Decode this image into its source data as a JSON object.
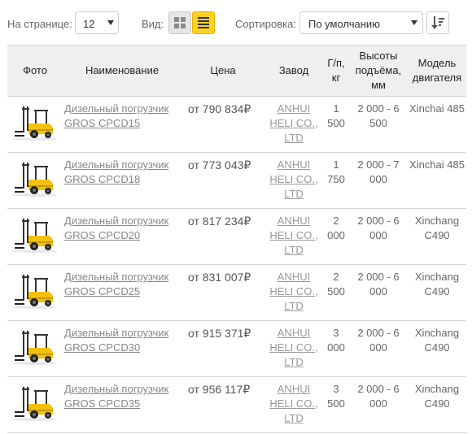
{
  "toolbar": {
    "per_page_label": "На странице:",
    "per_page_value": "12",
    "view_label": "Вид:",
    "sort_label": "Сортировка:",
    "sort_value": "По умолчанию",
    "accent_color": "#ffd21f"
  },
  "table": {
    "headers": {
      "photo": "Фото",
      "name": "Наименование",
      "price": "Цена",
      "factory": "Завод",
      "capacity": "Г/п, кг",
      "lift": "Высоты подъёма, мм",
      "engine": "Модель двигателя"
    },
    "rows": [
      {
        "name": "Дизельный погрузчик GROS CPCD15",
        "price": "от 790 834₽",
        "factory": "ANHUI HELI CO., LTD",
        "capacity": "1 500",
        "lift": "2 000 - 6 500",
        "engine": "Xinchai 485"
      },
      {
        "name": "Дизельный погрузчик GROS CPCD18",
        "price": "от 773 043₽",
        "factory": "ANHUI HELI CO., LTD",
        "capacity": "1 750",
        "lift": "2 000 - 7 000",
        "engine": "Xinchai 485"
      },
      {
        "name": "Дизельный погрузчик GROS CPCD20",
        "price": "от 817 234₽",
        "factory": "ANHUI HELI CO., LTD",
        "capacity": "2 000",
        "lift": "2 000 - 6 000",
        "engine": "Xinchang C490"
      },
      {
        "name": "Дизельный погрузчик GROS CPCD25",
        "price": "от 831 007₽",
        "factory": "ANHUI HELI CO., LTD",
        "capacity": "2 500",
        "lift": "2 000 - 6 000",
        "engine": "Xinchang C490"
      },
      {
        "name": "Дизельный погрузчик GROS CPCD30",
        "price": "от 915 371₽",
        "factory": "ANHUI HELI CO., LTD",
        "capacity": "3 000",
        "lift": "2 000 - 6 000",
        "engine": "Xinchang C490"
      },
      {
        "name": "Дизельный погрузчик GROS CPCD35",
        "price": "от 956 117₽",
        "factory": "ANHUI HELI CO., LTD",
        "capacity": "3 500",
        "lift": "2 000 - 6 000",
        "engine": "Xinchang C490"
      }
    ]
  }
}
